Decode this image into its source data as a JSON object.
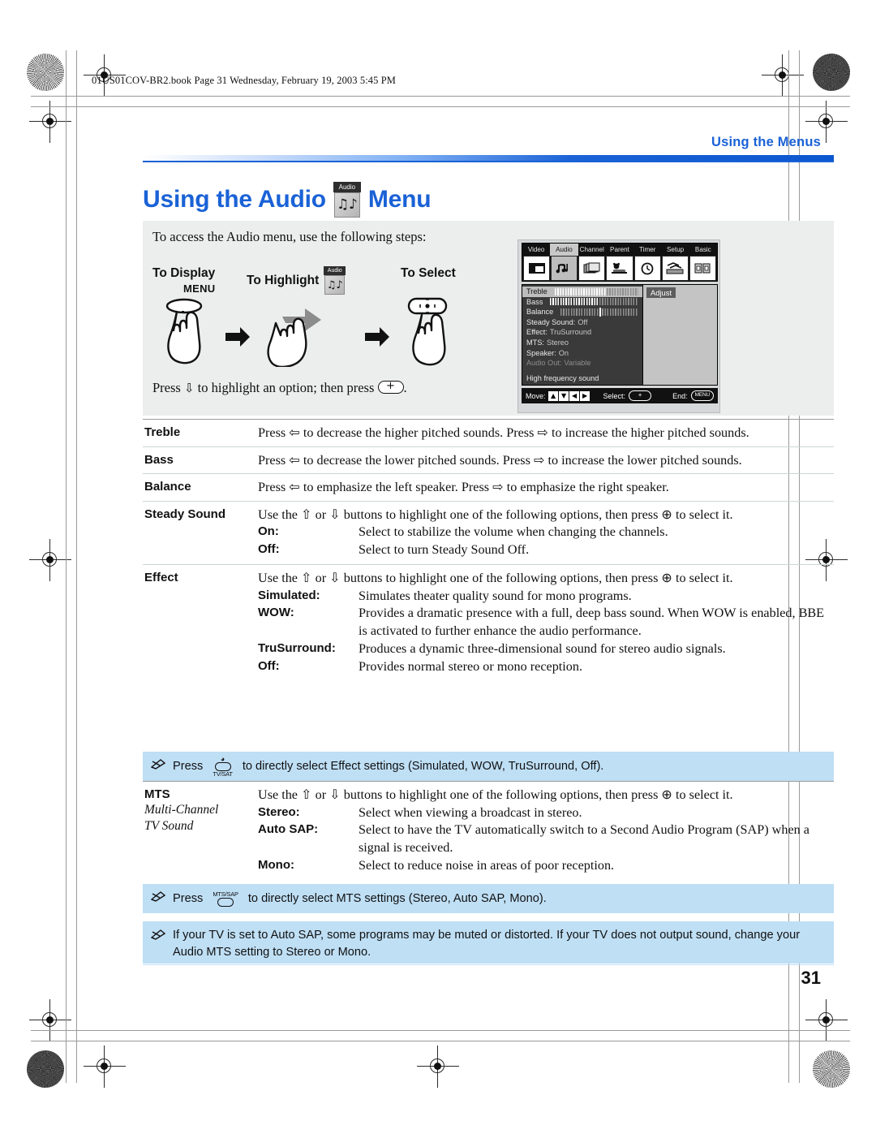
{
  "document": {
    "file_stamp": "01US01COV-BR2.book  Page 31  Wednesday, February 19, 2003  5:45 PM",
    "running_head": "Using the Menus",
    "page_number": "31"
  },
  "title": {
    "before_icon": "Using the Audio",
    "icon_caption": "Audio",
    "icon_glyph": "♫♪",
    "after_icon": "Menu"
  },
  "intro": {
    "lead": "To access the Audio menu, use the following steps:",
    "steps": [
      {
        "label": "To Display",
        "button": "MENU"
      },
      {
        "label": "To Highlight",
        "icon_caption": "Audio",
        "icon_glyph": "♫♪"
      },
      {
        "label": "To Select"
      }
    ],
    "footer_pre": "Press",
    "footer_mid": "to highlight an option; then press",
    "footer_end": "."
  },
  "osd": {
    "tabs": [
      "Video",
      "Audio",
      "Channel",
      "Parent",
      "Timer",
      "Setup",
      "Basic"
    ],
    "selected_tab": "Audio",
    "tab_icons": [
      "pip-icon",
      "music-note-icon",
      "channel-cards-icon",
      "teddy-bear-icon",
      "clock-icon",
      "setup-tools-icon",
      "basic-blocks-icon"
    ],
    "rows": [
      {
        "label": "Treble",
        "type": "bar",
        "fill": 62,
        "highlighted": true,
        "dimmed": false
      },
      {
        "label": "Bass",
        "type": "bar",
        "fill": 56,
        "highlighted": false,
        "dimmed": false
      },
      {
        "label": "Balance",
        "type": "center-bar",
        "fill": 50,
        "highlighted": false,
        "dimmed": false
      },
      {
        "label": "Steady Sound:",
        "value": "Off",
        "type": "value",
        "dimmed": false
      },
      {
        "label": "Effect:",
        "value": "TruSurround",
        "type": "value",
        "dimmed": false
      },
      {
        "label": "MTS:",
        "value": "Stereo",
        "type": "value",
        "dimmed": false
      },
      {
        "label": "Speaker:",
        "value": "On",
        "type": "value",
        "dimmed": false
      },
      {
        "label": "Audio Out:",
        "value": "Variable",
        "type": "value",
        "dimmed": true
      }
    ],
    "hint": "High frequency sound",
    "adjust_tag": "Adjust",
    "footer": {
      "move_label": "Move:",
      "select_label": "Select:",
      "end_label": "End:",
      "end_key": "MENU"
    }
  },
  "table": {
    "rows": [
      {
        "term": "Treble",
        "def": "Press ⇦ to decrease the higher pitched sounds. Press ⇨ to increase the higher pitched sounds."
      },
      {
        "term": "Bass",
        "def": "Press ⇦ to decrease the lower pitched sounds. Press ⇨ to increase the lower pitched sounds."
      },
      {
        "term": "Balance",
        "def": "Press ⇦ to emphasize the left speaker. Press ⇨ to emphasize the right speaker."
      },
      {
        "term": "Steady Sound",
        "def": "Use the ⇧ or ⇩ buttons to highlight one of the following options, then press ⊕ to select it.",
        "options": [
          {
            "key": "On:",
            "val": "Select to stabilize the volume when changing the channels."
          },
          {
            "key": "Off:",
            "val": "Select to turn Steady Sound Off."
          }
        ]
      },
      {
        "term": "Effect",
        "def": "Use the ⇧ or ⇩ buttons to highlight one of the following options, then press ⊕ to select it.",
        "options": [
          {
            "key": "Simulated:",
            "val": "Simulates theater quality sound for mono programs."
          },
          {
            "key": "WOW:",
            "val": "Provides a dramatic presence with a full, deep bass sound. When WOW is enabled, BBE is activated to further enhance the audio performance."
          },
          {
            "key": "TruSurround:",
            "val": "Produces a dynamic three-dimensional sound for stereo audio signals."
          },
          {
            "key": "Off:",
            "val": "Provides normal stereo or mono reception."
          }
        ]
      },
      {
        "term": "MTS",
        "term_sub_1": "Multi-Channel",
        "term_sub_2": "TV Sound",
        "def": "Use the ⇧ or ⇩ buttons to highlight one of the following options, then press ⊕ to select it.",
        "options": [
          {
            "key": "Stereo:",
            "val": "Select when viewing a broadcast in stereo."
          },
          {
            "key": "Auto SAP:",
            "val": "Select to have the TV automatically switch to a Second Audio Program (SAP) when a signal is received."
          },
          {
            "key": "Mono:",
            "val": "Select to reduce noise in areas of poor reception."
          }
        ]
      }
    ]
  },
  "notes": [
    {
      "pre": "Press",
      "button_caption": "TV/SAT",
      "post": "to directly select Effect settings (Simulated, WOW, TruSurround, Off)."
    },
    {
      "pre": "Press",
      "button_caption": "MTS/SAP",
      "post": "to directly select MTS settings (Stereo, Auto SAP, Mono)."
    },
    {
      "text": "If your TV is set to Auto SAP, some programs may be muted or distorted. If your TV does not output sound, change your Audio MTS setting to Stereo or Mono."
    }
  ],
  "colors": {
    "accent_blue": "#1a62d6",
    "note_blue": "#bfdff5",
    "panel_grey": "#eceded"
  }
}
